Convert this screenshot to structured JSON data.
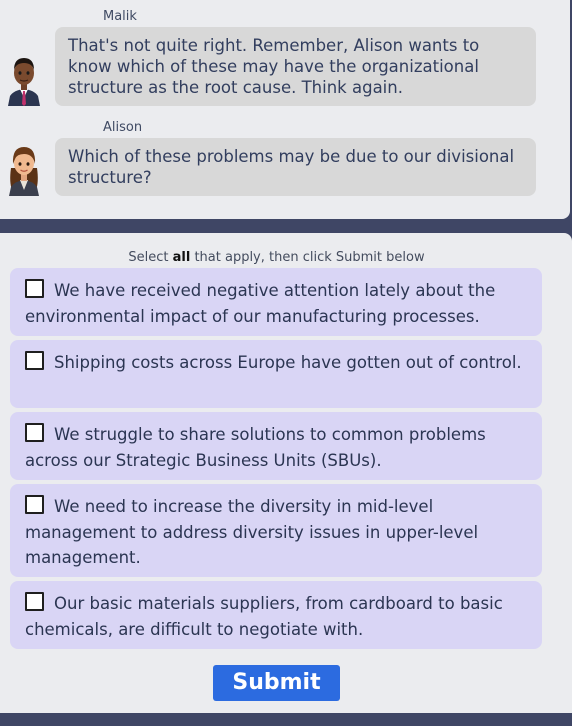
{
  "chat": {
    "messages": [
      {
        "sender": "Malik",
        "text": "That's not quite right. Remember, Alison wants to know which of these may have the organizational structure as the root cause. Think again."
      },
      {
        "sender": "Alison",
        "text": "Which of these problems may be due to our divisional structure?"
      }
    ]
  },
  "question": {
    "instruction_prefix": "Select ",
    "instruction_bold": "all",
    "instruction_suffix": " that apply, then click Submit below",
    "options": [
      {
        "text": "We have received negative attention lately about the environmental impact of our manufacturing processes.",
        "checked": false
      },
      {
        "text": "Shipping costs across Europe have gotten out of control.",
        "checked": false
      },
      {
        "text": "We struggle to share solutions to common problems across our Strategic Business Units (SBUs).",
        "checked": false
      },
      {
        "text": "We need to increase the diversity in mid-level management to address diversity issues in upper-level management.",
        "checked": false
      },
      {
        "text": "Our basic materials suppliers, from cardboard to basic chemicals, are difficult to negotiate with.",
        "checked": false
      }
    ],
    "submit_label": "Submit"
  },
  "colors": {
    "frame": "#3f4665",
    "panel": "#ebecef",
    "bubble": "#d8d8d8",
    "option_bg": "#d9d5f5",
    "submit": "#2c6be0"
  },
  "icons": {
    "malik_avatar": "male-avatar-icon",
    "alison_avatar": "female-avatar-icon",
    "checkbox": "checkbox-icon"
  }
}
